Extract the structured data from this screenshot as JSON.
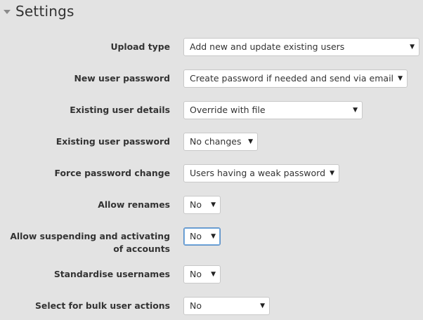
{
  "section": {
    "title": "Settings"
  },
  "fields": [
    {
      "label": "Upload type",
      "value": "Add new and update existing users"
    },
    {
      "label": "New user password",
      "value": "Create password if needed and send via email"
    },
    {
      "label": "Existing user details",
      "value": "Override with file"
    },
    {
      "label": "Existing user password",
      "value": "No changes"
    },
    {
      "label": "Force password change",
      "value": "Users having a weak password"
    },
    {
      "label": "Allow renames",
      "value": "No"
    },
    {
      "label": "Allow suspending and activating of accounts",
      "value": "No"
    },
    {
      "label": "Standardise usernames",
      "value": "No"
    },
    {
      "label": "Select for bulk user actions",
      "value": "No"
    }
  ],
  "icons": {
    "collapse": "caret-down-icon",
    "dropdown": "dropdown-arrow-icon"
  }
}
